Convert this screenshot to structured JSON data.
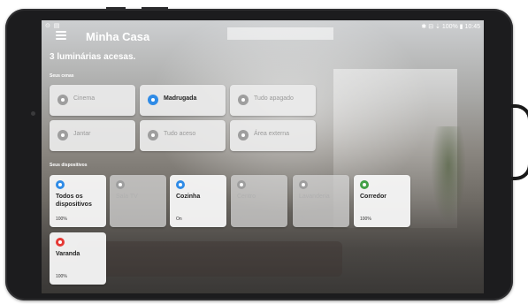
{
  "colors": {
    "on_blue": "#2f8be6",
    "on_green": "#43a047",
    "on_red": "#e53935",
    "off_grey": "#9e9e9e"
  },
  "status_bar": {
    "left": "⊙ ▤",
    "right": "✱ ⊟ ⇣ 100% ▮ 10:45"
  },
  "app": {
    "title": "Minha Casa",
    "summary": "3 luminárias acesas.",
    "menu_icon": "hamburger-menu-icon"
  },
  "scenes": {
    "label": "Seus cenas",
    "items": [
      {
        "label": "Cinema",
        "active": false
      },
      {
        "label": "Madrugada",
        "active": true
      },
      {
        "label": "Tudo apagado",
        "active": false
      },
      {
        "label": "Jantar",
        "active": false
      },
      {
        "label": "Tudo aceso",
        "active": false
      },
      {
        "label": "Área externa",
        "active": false
      }
    ]
  },
  "devices": {
    "label": "Seus dispositivos",
    "items": [
      {
        "name": "Todos os dispositivos",
        "value": "100%",
        "on": true,
        "color": "blue"
      },
      {
        "name": "Sala TV",
        "value": "Off",
        "on": false,
        "color": "grey"
      },
      {
        "name": "Cozinha",
        "value": "On",
        "on": true,
        "color": "blue"
      },
      {
        "name": "Centro",
        "value": "Off",
        "on": false,
        "color": "grey"
      },
      {
        "name": "Lavanderia",
        "value": "Off",
        "on": false,
        "color": "grey"
      },
      {
        "name": "Corredor",
        "value": "100%",
        "on": true,
        "color": "green"
      },
      {
        "name": "Varanda",
        "value": "100%",
        "on": true,
        "color": "red"
      }
    ]
  }
}
